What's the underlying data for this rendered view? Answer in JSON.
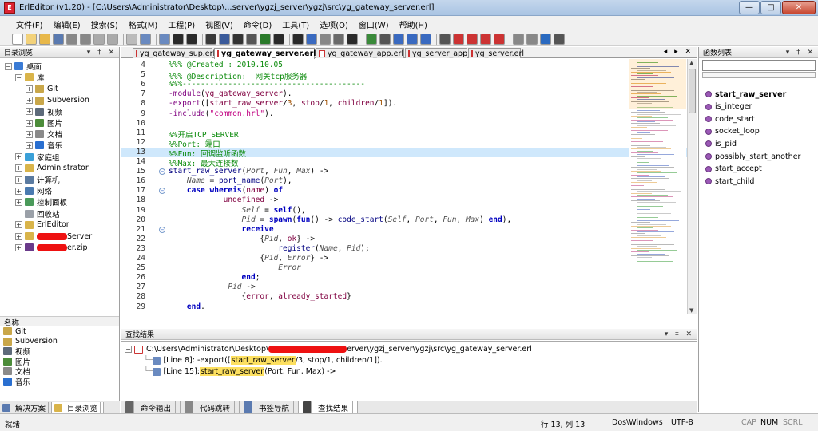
{
  "window": {
    "title": "ErlEditor (v1.20) - [C:\\Users\\Administrator\\Desktop\\...server\\ygzj_server\\ygzj\\src\\yg_gateway_server.erl]",
    "btn_min": "—",
    "btn_max": "□",
    "btn_close": "✕"
  },
  "menu": [
    "文件(F)",
    "编辑(E)",
    "搜索(S)",
    "格式(M)",
    "工程(P)",
    "视图(V)",
    "命令(D)",
    "工具(T)",
    "选项(O)",
    "窗口(W)",
    "帮助(H)"
  ],
  "left_panel": {
    "title": "目录浏览",
    "tree": [
      {
        "label": "桌面",
        "indent": 0,
        "exp": "⊟",
        "color": "#3a7bd5"
      },
      {
        "label": "库",
        "indent": 1,
        "exp": "⊟",
        "color": "#d9b44a"
      },
      {
        "label": "Git",
        "indent": 2,
        "exp": "⊞",
        "color": "#c9a74a"
      },
      {
        "label": "Subversion",
        "indent": 2,
        "exp": "⊞",
        "color": "#c9a74a"
      },
      {
        "label": "视频",
        "indent": 2,
        "exp": "⊞",
        "color": "#5d6a7a"
      },
      {
        "label": "图片",
        "indent": 2,
        "exp": "⊞",
        "color": "#4c8c3a"
      },
      {
        "label": "文档",
        "indent": 2,
        "exp": "⊞",
        "color": "#8a8a8a"
      },
      {
        "label": "音乐",
        "indent": 2,
        "exp": "⊞",
        "color": "#2a6fd0"
      },
      {
        "label": "家庭组",
        "indent": 1,
        "exp": "⊞",
        "color": "#3aa0d8"
      },
      {
        "label": "Administrator",
        "indent": 1,
        "exp": "⊞",
        "color": "#d9b44a"
      },
      {
        "label": "计算机",
        "indent": 1,
        "exp": "⊞",
        "color": "#5a7aa0"
      },
      {
        "label": "网络",
        "indent": 1,
        "exp": "⊞",
        "color": "#4a7ab0"
      },
      {
        "label": "控制面板",
        "indent": 1,
        "exp": "⊞",
        "color": "#4a9a5a"
      },
      {
        "label": "回收站",
        "indent": 1,
        "exp": "",
        "color": "#9aa0a8"
      },
      {
        "label": "ErlEditor",
        "indent": 1,
        "exp": "⊞",
        "color": "#d9b44a"
      },
      {
        "label": "Server",
        "indent": 1,
        "exp": "⊞",
        "color": "#d9b44a",
        "redacted_prefix": true
      },
      {
        "label": "er.zip",
        "indent": 1,
        "exp": "⊞",
        "color": "#6a3a8a",
        "redacted_prefix": true
      }
    ],
    "name_header": "名称",
    "names": [
      {
        "label": "Git",
        "color": "#c9a74a"
      },
      {
        "label": "Subversion",
        "color": "#c9a74a"
      },
      {
        "label": "视频",
        "color": "#5d6a7a"
      },
      {
        "label": "图片",
        "color": "#4c8c3a"
      },
      {
        "label": "文档",
        "color": "#8a8a8a"
      },
      {
        "label": "音乐",
        "color": "#2a6fd0"
      }
    ],
    "tabs": [
      "解决方案",
      "目录浏览"
    ]
  },
  "doc_tabs": [
    "yg_gateway_sup.erl",
    "yg_gateway_server.erl",
    "yg_gateway_app.erl",
    "yg_server_app.erl",
    "yg_server.erl"
  ],
  "active_doc_tab": 1,
  "code": [
    {
      "n": "4",
      "fold": "",
      "parts": [
        [
          "c-com",
          "%%% @Created : 2010.10.05"
        ]
      ]
    },
    {
      "n": "5",
      "fold": "",
      "parts": [
        [
          "c-com",
          "%%% @Description:  网关tcp服务器"
        ]
      ]
    },
    {
      "n": "6",
      "fold": "",
      "parts": [
        [
          "c-com",
          "%%%----------------------------------------"
        ]
      ]
    },
    {
      "n": "7",
      "fold": "",
      "parts": [
        [
          "c-mod",
          "-module"
        ],
        [
          "c-op",
          "("
        ],
        [
          "c-atom",
          "yg_gateway_server"
        ],
        [
          "c-op",
          ")."
        ]
      ]
    },
    {
      "n": "8",
      "fold": "",
      "parts": [
        [
          "c-mod",
          "-export"
        ],
        [
          "c-op",
          "(["
        ],
        [
          "c-atom",
          "start_raw_server"
        ],
        [
          "c-op",
          "/"
        ],
        [
          "c-num",
          "3"
        ],
        [
          "c-op",
          ", "
        ],
        [
          "c-atom",
          "stop"
        ],
        [
          "c-op",
          "/"
        ],
        [
          "c-num",
          "1"
        ],
        [
          "c-op",
          ", "
        ],
        [
          "c-atom",
          "children"
        ],
        [
          "c-op",
          "/"
        ],
        [
          "c-num",
          "1"
        ],
        [
          "c-op",
          "])."
        ]
      ]
    },
    {
      "n": "9",
      "fold": "",
      "parts": [
        [
          "c-mod",
          "-include"
        ],
        [
          "c-op",
          "("
        ],
        [
          "c-str",
          "\"common.hrl\""
        ],
        [
          "c-op",
          ")."
        ]
      ]
    },
    {
      "n": "10",
      "fold": "",
      "parts": []
    },
    {
      "n": "11",
      "fold": "",
      "parts": [
        [
          "c-com",
          "%%开启TCP_SERVER"
        ]
      ]
    },
    {
      "n": "12",
      "fold": "",
      "parts": [
        [
          "c-com",
          "%%Port: 端口"
        ]
      ]
    },
    {
      "n": "13",
      "fold": "",
      "parts": [
        [
          "c-com",
          "%%Fun: 回调监听函数"
        ]
      ],
      "hl": true
    },
    {
      "n": "14",
      "fold": "",
      "parts": [
        [
          "c-com",
          "%%Max: 最大连接数"
        ]
      ]
    },
    {
      "n": "15",
      "fold": "⊖",
      "parts": [
        [
          "c-fn",
          "start_raw_server"
        ],
        [
          "c-op",
          "("
        ],
        [
          "c-var",
          "Port"
        ],
        [
          "c-op",
          ", "
        ],
        [
          "c-var",
          "Fun"
        ],
        [
          "c-op",
          ", "
        ],
        [
          "c-var",
          "Max"
        ],
        [
          "c-op",
          ") ->"
        ]
      ]
    },
    {
      "n": "16",
      "fold": "",
      "parts": [
        [
          "c-op",
          "    "
        ],
        [
          "c-var",
          "Name"
        ],
        [
          "c-op",
          " = "
        ],
        [
          "c-fn",
          "port_name"
        ],
        [
          "c-op",
          "("
        ],
        [
          "c-var",
          "Port"
        ],
        [
          "c-op",
          "),"
        ]
      ]
    },
    {
      "n": "17",
      "fold": "⊖",
      "parts": [
        [
          "c-op",
          "    "
        ],
        [
          "c-kw",
          "case"
        ],
        [
          "c-op",
          " "
        ],
        [
          "c-kw",
          "whereis"
        ],
        [
          "c-op",
          "("
        ],
        [
          "c-atom",
          "name"
        ],
        [
          "c-op",
          ") "
        ],
        [
          "c-kw",
          "of"
        ]
      ]
    },
    {
      "n": "18",
      "fold": "",
      "parts": [
        [
          "c-op",
          "            "
        ],
        [
          "c-atom",
          "undefined"
        ],
        [
          "c-op",
          " ->"
        ]
      ]
    },
    {
      "n": "19",
      "fold": "",
      "parts": [
        [
          "c-op",
          "                "
        ],
        [
          "c-var",
          "Self"
        ],
        [
          "c-op",
          " = "
        ],
        [
          "c-kw",
          "self"
        ],
        [
          "c-op",
          "(),"
        ]
      ]
    },
    {
      "n": "20",
      "fold": "",
      "parts": [
        [
          "c-op",
          "                "
        ],
        [
          "c-var",
          "Pid"
        ],
        [
          "c-op",
          " = "
        ],
        [
          "c-kw",
          "spawn"
        ],
        [
          "c-op",
          "("
        ],
        [
          "c-kw",
          "fun"
        ],
        [
          "c-op",
          "() -> "
        ],
        [
          "c-fn",
          "code_start"
        ],
        [
          "c-op",
          "("
        ],
        [
          "c-var",
          "Self"
        ],
        [
          "c-op",
          ", "
        ],
        [
          "c-var",
          "Port"
        ],
        [
          "c-op",
          ", "
        ],
        [
          "c-var",
          "Fun"
        ],
        [
          "c-op",
          ", "
        ],
        [
          "c-var",
          "Max"
        ],
        [
          "c-op",
          ") "
        ],
        [
          "c-kw",
          "end"
        ],
        [
          "c-op",
          "),"
        ]
      ]
    },
    {
      "n": "21",
      "fold": "⊖",
      "parts": [
        [
          "c-op",
          "                "
        ],
        [
          "c-kw",
          "receive"
        ]
      ]
    },
    {
      "n": "22",
      "fold": "",
      "parts": [
        [
          "c-op",
          "                    {"
        ],
        [
          "c-var",
          "Pid"
        ],
        [
          "c-op",
          ", "
        ],
        [
          "c-atom",
          "ok"
        ],
        [
          "c-op",
          "} ->"
        ]
      ]
    },
    {
      "n": "23",
      "fold": "",
      "parts": [
        [
          "c-op",
          "                        "
        ],
        [
          "c-fn",
          "register"
        ],
        [
          "c-op",
          "("
        ],
        [
          "c-var",
          "Name"
        ],
        [
          "c-op",
          ", "
        ],
        [
          "c-var",
          "Pid"
        ],
        [
          "c-op",
          ");"
        ]
      ]
    },
    {
      "n": "24",
      "fold": "",
      "parts": [
        [
          "c-op",
          "                    {"
        ],
        [
          "c-var",
          "Pid"
        ],
        [
          "c-op",
          ", "
        ],
        [
          "c-var",
          "Error"
        ],
        [
          "c-op",
          "} ->"
        ]
      ]
    },
    {
      "n": "25",
      "fold": "",
      "parts": [
        [
          "c-op",
          "                        "
        ],
        [
          "c-var",
          "Error"
        ]
      ]
    },
    {
      "n": "26",
      "fold": "",
      "parts": [
        [
          "c-op",
          "                "
        ],
        [
          "c-kw",
          "end"
        ],
        [
          "c-op",
          ";"
        ]
      ]
    },
    {
      "n": "27",
      "fold": "",
      "parts": [
        [
          "c-op",
          "            _"
        ],
        [
          "c-var",
          "Pid"
        ],
        [
          "c-op",
          " ->"
        ]
      ]
    },
    {
      "n": "28",
      "fold": "",
      "parts": [
        [
          "c-op",
          "                {"
        ],
        [
          "c-atom",
          "error"
        ],
        [
          "c-op",
          ", "
        ],
        [
          "c-atom",
          "already_started"
        ],
        [
          "c-op",
          "}"
        ]
      ]
    },
    {
      "n": "29",
      "fold": "",
      "parts": [
        [
          "c-op",
          "    "
        ],
        [
          "c-kw",
          "end"
        ],
        [
          "c-op",
          "."
        ]
      ]
    }
  ],
  "results_panel": {
    "title": "查找结果",
    "file_path": "C:\\Users\\Administrator\\Desktop\\",
    "file_path_tail": "erver\\ygzj_server\\ygzj\\src\\yg_gateway_server.erl",
    "lines": [
      {
        "prefix": "[Line 8]:  -export([",
        "match": "start_raw_server",
        "suffix": "/3, stop/1, children/1])."
      },
      {
        "prefix": "[Line 15]:  ",
        "match": "start_raw_server",
        "suffix": "(Port, Fun, Max) ->"
      }
    ]
  },
  "bottom_tabs": [
    "命令输出",
    "代码跳转",
    "书签导航",
    "查找结果"
  ],
  "right_panel": {
    "title": "函数列表",
    "functions": [
      "start_raw_server",
      "is_integer",
      "code_start",
      "socket_loop",
      "is_pid",
      "possibly_start_another",
      "start_accept",
      "start_child"
    ]
  },
  "status": {
    "ready": "就绪",
    "position": "行 13, 列 13",
    "line_ending": "Dos\\Windows",
    "encoding": "UTF-8",
    "cap": "CAP",
    "num": "NUM",
    "scrl": "SCRL"
  },
  "colors": {
    "highlight_line": "#cfe8fc",
    "match_highlight": "#fde060",
    "comment": "#0a8a0a"
  }
}
